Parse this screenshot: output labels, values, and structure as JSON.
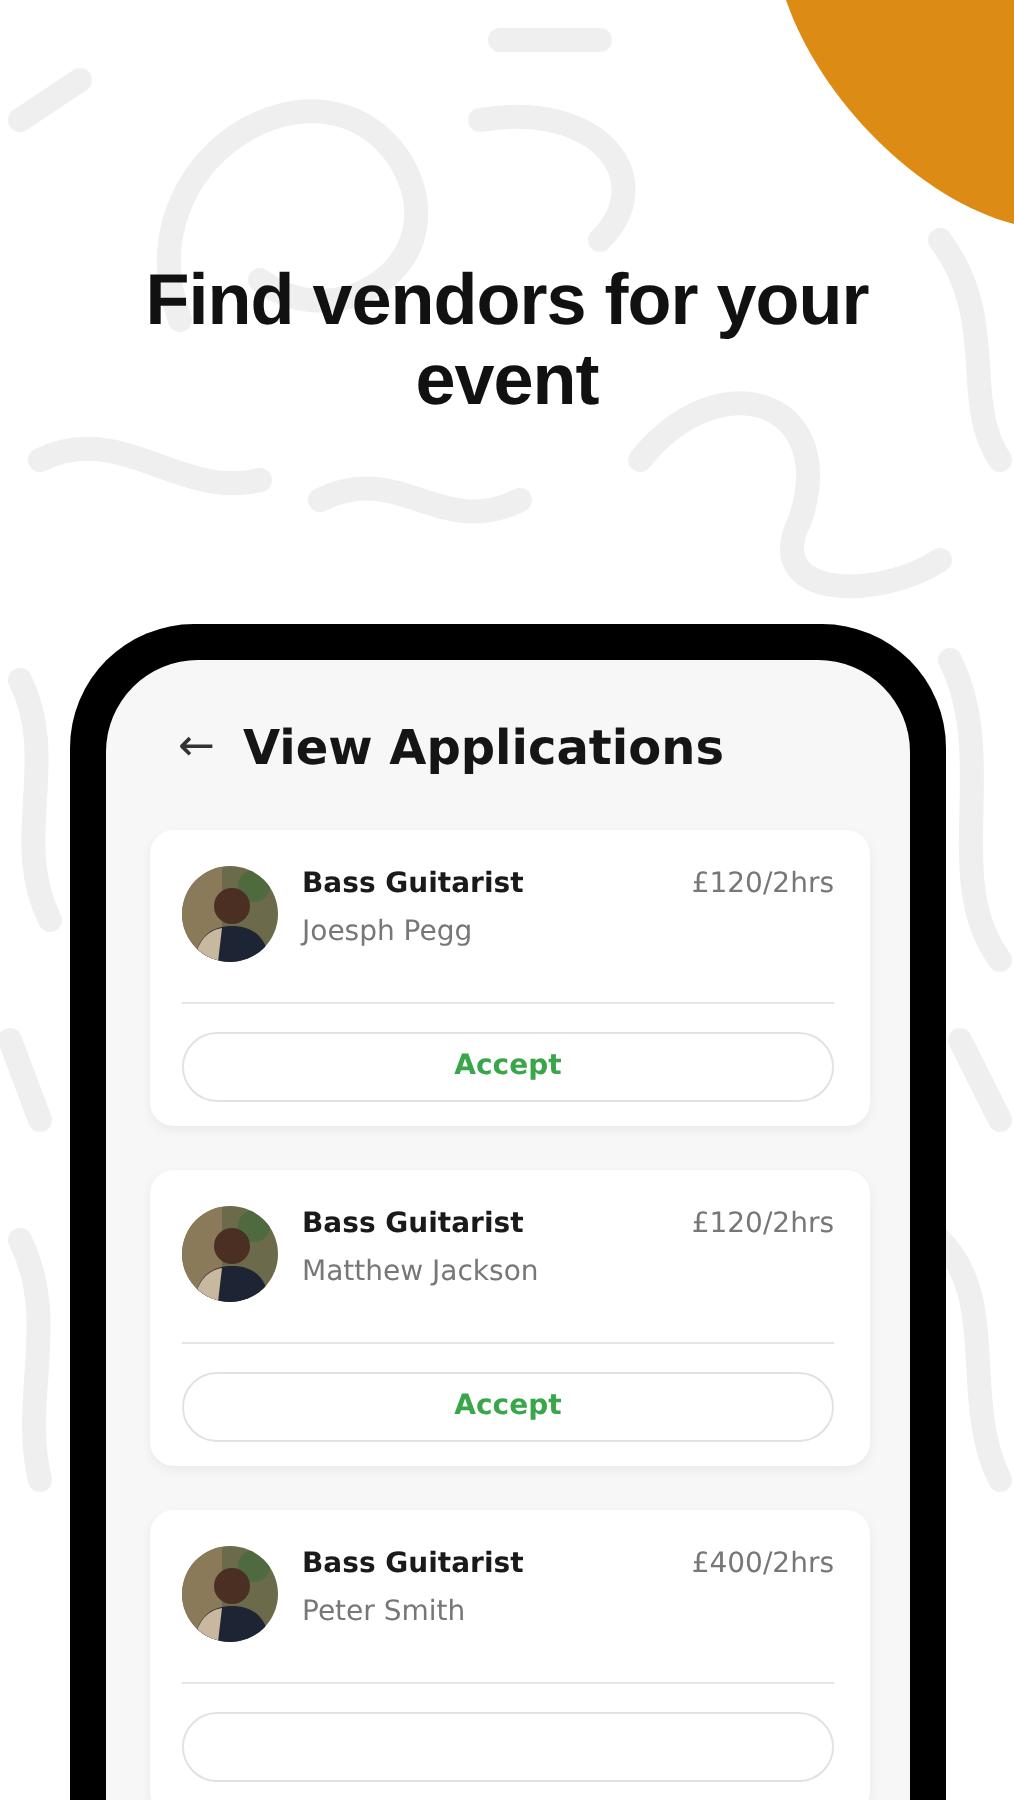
{
  "headline": "Find vendors for your event",
  "screen": {
    "back": "←",
    "title": "View Applications"
  },
  "applications": [
    {
      "role": "Bass Guitarist",
      "name": "Joesph Pegg",
      "price": "£120/2hrs",
      "action": {
        "kind": "accept",
        "label": "Accept"
      }
    },
    {
      "role": "Bass Guitarist",
      "name": "Matthew Jackson",
      "price": "£120/2hrs",
      "action": {
        "kind": "accept",
        "label": "Accept"
      }
    },
    {
      "role": "Bass Guitarist",
      "name": "Peter Smith",
      "price": "£400/2hrs",
      "action": {
        "kind": "quote"
      }
    }
  ]
}
